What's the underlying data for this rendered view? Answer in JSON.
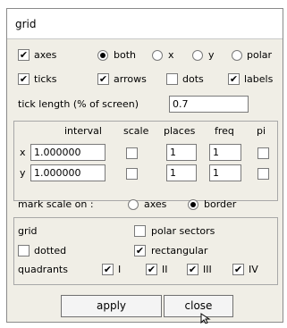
{
  "window": {
    "title": "grid"
  },
  "row1": {
    "axes": {
      "label": "axes",
      "checked": true
    },
    "mode_both": {
      "label": "both",
      "selected": true
    },
    "mode_x": {
      "label": "x",
      "selected": false
    },
    "mode_y": {
      "label": "y",
      "selected": false
    },
    "mode_polar": {
      "label": "polar",
      "selected": false
    }
  },
  "row2": {
    "ticks": {
      "label": "ticks",
      "checked": true
    },
    "arrows": {
      "label": "arrows",
      "checked": true
    },
    "dots": {
      "label": "dots",
      "checked": false
    },
    "labels": {
      "label": "labels",
      "checked": true
    }
  },
  "tick_length": {
    "label": "tick length (% of screen)",
    "value": "0.7"
  },
  "table": {
    "headers": {
      "interval": "interval",
      "scale": "scale",
      "places": "places",
      "freq": "freq",
      "pi": "pi"
    },
    "rows": [
      {
        "axis": "x",
        "interval": "1.000000",
        "scale": false,
        "places": "1",
        "freq": "1",
        "pi": false
      },
      {
        "axis": "y",
        "interval": "1.000000",
        "scale": false,
        "places": "1",
        "freq": "1",
        "pi": false
      }
    ]
  },
  "mark_scale": {
    "label": "mark scale on :",
    "axes": {
      "label": "axes",
      "selected": false
    },
    "border": {
      "label": "border",
      "selected": true
    }
  },
  "grid_group": {
    "grid_label": "grid",
    "polar_sectors": {
      "label": "polar sectors",
      "checked": false
    },
    "dotted": {
      "label": "dotted",
      "checked": false
    },
    "rectangular": {
      "label": "rectangular",
      "checked": true
    },
    "quadrants_label": "quadrants",
    "quadrants": [
      {
        "label": "I",
        "checked": true
      },
      {
        "label": "II",
        "checked": true
      },
      {
        "label": "III",
        "checked": true
      },
      {
        "label": "IV",
        "checked": true
      }
    ]
  },
  "buttons": {
    "apply": "apply",
    "close": "close"
  },
  "check_glyph": "✔"
}
